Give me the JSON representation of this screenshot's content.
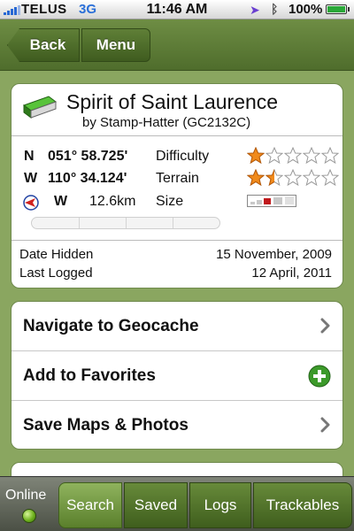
{
  "status_bar": {
    "carrier": "TELUS",
    "network": "3G",
    "time": "11:46 AM",
    "battery": "100%",
    "battery_level": 1.0,
    "signal_bars": 4
  },
  "nav": {
    "back_label": "Back",
    "menu_label": "Menu"
  },
  "cache": {
    "title": "Spirit of Saint Laurence",
    "byline": "by Stamp-Hatter (GC2132C)",
    "lat_dir": "N",
    "lat": "051° 58.725'",
    "lon_dir": "W",
    "lon": "110° 34.124'",
    "bearing": "W",
    "distance": "12.6km",
    "difficulty_label": "Difficulty",
    "difficulty_rating": 1.0,
    "terrain_label": "Terrain",
    "terrain_rating": 1.5,
    "size_label": "Size",
    "date_hidden_label": "Date Hidden",
    "date_hidden": "15 November, 2009",
    "last_logged_label": "Last Logged",
    "last_logged": "12 April, 2011"
  },
  "actions": {
    "navigate_label": "Navigate to Geocache",
    "favorites_label": "Add to Favorites",
    "save_maps_label": "Save Maps & Photos"
  },
  "tab_bar": {
    "online_label": "Online",
    "search_label": "Search",
    "saved_label": "Saved",
    "logs_label": "Logs",
    "trackables_label": "Trackables"
  },
  "colors": {
    "accent_green": "#5a7f2c",
    "star_orange": "#f08a1c",
    "plus_green": "#3c9a2a",
    "compass_red": "#d0211e"
  }
}
